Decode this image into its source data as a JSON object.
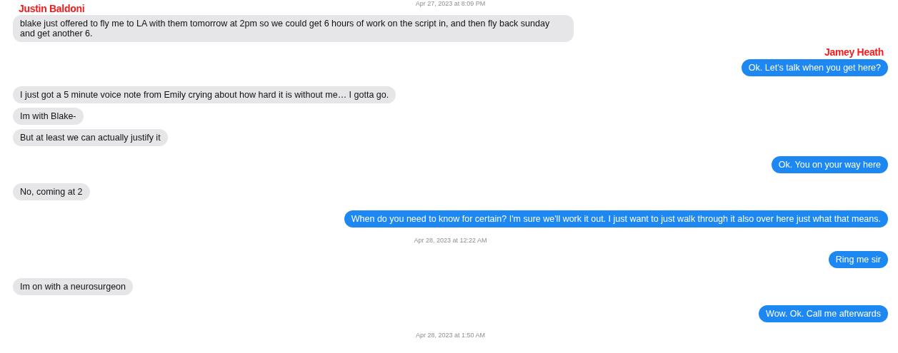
{
  "messages": [
    {
      "kind": "sender_left",
      "text": "Justin Baldoni"
    },
    {
      "kind": "timestamp",
      "text": "Apr 27, 2023 at 8:09 PM"
    },
    {
      "kind": "incoming",
      "text": "blake just offered to fly me to LA with them tomorrow at 2pm so we could get 6 hours of work on the script in, and then fly back sunday and get another 6."
    },
    {
      "kind": "sender_right",
      "text": "Jamey Heath"
    },
    {
      "kind": "outgoing",
      "text": "Ok.  Let's talk when you get here?"
    },
    {
      "kind": "incoming",
      "text": "I just got a 5 minute voice note from Emily crying about how hard it is without me… I gotta go."
    },
    {
      "kind": "incoming",
      "text": "Im with Blake-"
    },
    {
      "kind": "incoming",
      "text": "But at least we can actually justify it"
    },
    {
      "kind": "outgoing",
      "text": "Ok. You on your way here"
    },
    {
      "kind": "incoming",
      "text": "No, coming at 2"
    },
    {
      "kind": "outgoing",
      "text": "When do you need to know for certain? I'm sure we'll work it out. I just want to just walk through it also over here just what that means."
    },
    {
      "kind": "timestamp",
      "text": "Apr 28, 2023 at 12:22 AM"
    },
    {
      "kind": "outgoing",
      "text": "Ring me sir"
    },
    {
      "kind": "incoming",
      "text": "Im on with a neurosurgeon"
    },
    {
      "kind": "outgoing",
      "text": "Wow. Ok. Call me afterwards"
    },
    {
      "kind": "timestamp",
      "text": "Apr 28, 2023 at 1:50 AM"
    }
  ]
}
